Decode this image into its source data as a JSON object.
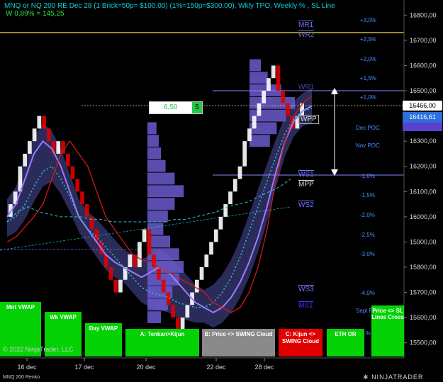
{
  "header": {
    "title": "MNQ or NQ 200 RE Dec 28 (1 Brick=50p= $100.00) (1%=150p=$300.00), Wkly TPO, Weekly % , SL Line",
    "weekly_pct": "W 0,89% = 145,25"
  },
  "colors": {
    "background": "#000000",
    "bull_brick": "#ffffff",
    "bear_brick": "#e00000",
    "tpo_profile": "#6a5acd",
    "cloud": "#3a3a78",
    "cyan_line": "#2ec6d6",
    "violet_line": "#9a7cff",
    "red_line": "#d21919",
    "gold_line": "#f2dc3c",
    "accent_green": "#00c800"
  },
  "price_box": {
    "value": "6,50",
    "side": "5"
  },
  "price_tags": {
    "current": "16466,00",
    "secondary": "16416,61"
  },
  "axis": {
    "y_ticks": [
      "16800,00",
      "16700,00",
      "16600,00",
      "16500,00",
      "16400,00",
      "16300,00",
      "16200,00",
      "16100,00",
      "16000,00",
      "15900,00",
      "15800,00",
      "15700,00",
      "15600,00",
      "15500,00"
    ],
    "x_ticks": [
      "16 dec",
      "17 dec",
      "20 dec",
      "22 dec",
      "28 dec"
    ],
    "pct_levels": [
      "+3,0%",
      "+2,5%",
      "+2,0%",
      "+1,5%",
      "+1,0%",
      "-1,0%",
      "-1,5%",
      "-2,0%",
      "-2,5%",
      "-3,0%",
      "-4,0%"
    ]
  },
  "levels": {
    "mr1": "MR1",
    "wr2": "WR2",
    "wr1": "WR1",
    "wpp": "WPP",
    "ws1": "WS1",
    "mpp": "MPP",
    "ws2": "WS2",
    "ws3": "WS3",
    "ms1": "MS1",
    "dec_poc": "Dec POC",
    "nov_poc": "Nov POC",
    "sept": "Sept P",
    "pct_partial": "%"
  },
  "buttons": {
    "mnt_vwap": "Mnt VWAP",
    "wk_vwap": "Wk VWAP",
    "day_vwap": "Day VWAP",
    "tenkan_kijun": "A: Tenkan>Kijun",
    "price_swing": "B: Price <> SWING Cloud",
    "kijun_swing": "C: Kijun <> SWING Cloud",
    "eth_or": "ETH OR",
    "price_sl": "Price <> SL Lines Cross"
  },
  "footer": {
    "copyright": "© 2022 NinjaTrader, LLC",
    "instrument": "MNQ 200 Renko",
    "brand": "NINJATRADER"
  },
  "chart_data": {
    "type": "line",
    "instrument": "MNQ or NQ 200 RE Dec 28",
    "ylim": [
      15440,
      16860
    ],
    "renko_closes": [
      16050,
      16100,
      16200,
      16250,
      16300,
      16350,
      16400,
      16350,
      16300,
      16250,
      16300,
      16250,
      16200,
      16150,
      16100,
      16050,
      16000,
      15950,
      15900,
      15850,
      15800,
      15750,
      15700,
      15750,
      15800,
      15850,
      15800,
      15900,
      15950,
      15850,
      15800,
      15750,
      15700,
      15650,
      15600,
      15550,
      15600,
      15650,
      15700,
      15750,
      15800,
      15850,
      15900,
      15950,
      16000,
      16050,
      16100,
      16150,
      16200,
      16300,
      16350,
      16400,
      16450,
      16500,
      16550,
      16600,
      16500,
      16450,
      16400,
      16350,
      16400,
      16450
    ],
    "series": [
      {
        "values": [
          16000,
          16050,
          16150,
          16250,
          16300,
          16270,
          16200,
          16100,
          16000,
          15950,
          15900,
          15850,
          15820,
          15800,
          15780,
          15760,
          15780,
          15800,
          15780,
          15740,
          15700,
          15660,
          15640,
          15620,
          15640,
          15680,
          15740,
          15820,
          15920,
          16040,
          16180,
          16300,
          16380,
          16420,
          16440
        ]
      },
      {
        "values": [
          15980,
          16000,
          16050,
          16120,
          16180,
          16200,
          16150,
          16080,
          16000,
          15950,
          15920,
          15880,
          15840,
          15800,
          15760,
          15720,
          15700,
          15690,
          15680,
          15660,
          15650,
          15640,
          15640,
          15660,
          15700,
          15760,
          15840,
          15940,
          16040,
          16140,
          16240,
          16330,
          16390,
          16420,
          16430
        ]
      },
      {
        "values": [
          15900,
          15920,
          15960,
          16000,
          16050,
          16150,
          16250,
          16300,
          16250,
          16200,
          16100,
          16000,
          15950,
          15900,
          15850,
          15830,
          15820,
          15800,
          15780,
          15760,
          15740,
          15720,
          15700,
          15660,
          15640,
          15620,
          15640,
          15700,
          15800,
          15950,
          16150,
          16300,
          16400,
          16450,
          16480
        ]
      },
      {
        "values": [
          15980,
          16020,
          16040,
          16020,
          16010,
          16000,
          16000,
          16000,
          15990,
          15990,
          15980,
          15980,
          15980,
          15980,
          15980,
          15980,
          15990,
          15990,
          16000,
          16010,
          16020,
          16040,
          16050,
          16060,
          16080,
          16100,
          16120,
          16150
        ]
      }
    ],
    "tpo_profiles": [
      {
        "date": "20 dec",
        "levels": [
          15600,
          15650,
          15700,
          15750,
          15800,
          15850,
          15900,
          15950,
          16000,
          16050,
          16100,
          16150,
          16200,
          16250,
          16300,
          16350
        ],
        "counts": [
          6,
          9,
          11,
          14,
          16,
          14,
          10,
          7,
          9,
          12,
          16,
          12,
          8,
          6,
          5,
          4
        ]
      },
      {
        "date": "28 dec",
        "levels": [
          16300,
          16350,
          16400,
          16450,
          16500,
          16550,
          16600
        ],
        "counts": [
          9,
          12,
          16,
          20,
          14,
          8,
          5
        ]
      }
    ]
  }
}
